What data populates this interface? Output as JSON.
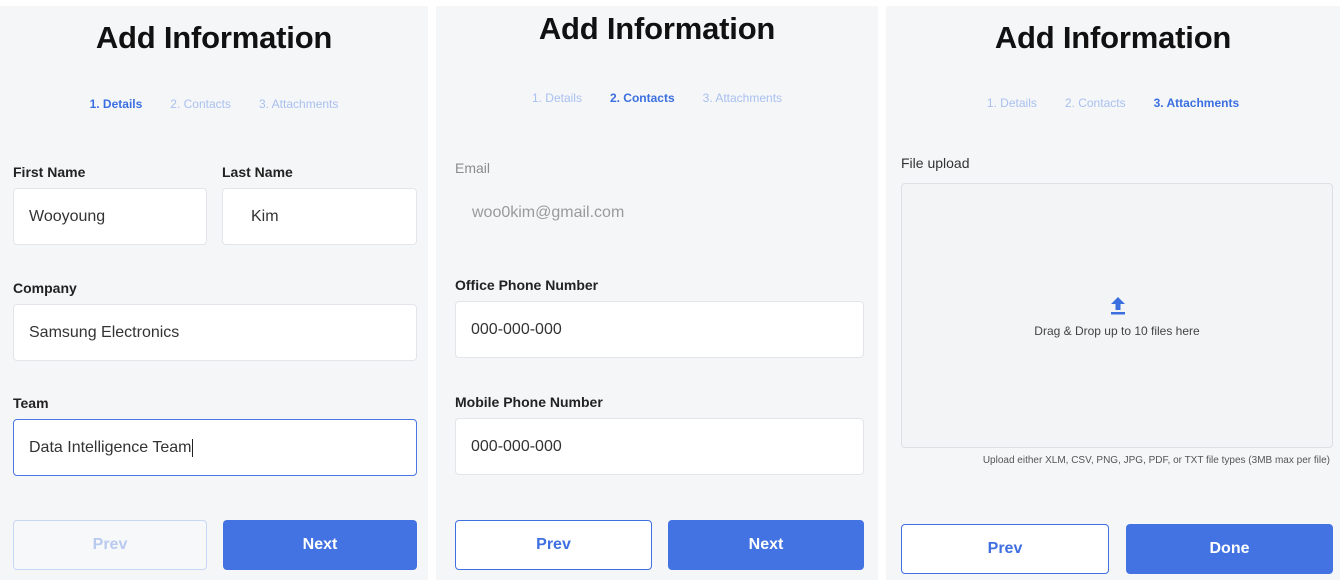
{
  "title": "Add Information",
  "steps": [
    "1. Details",
    "2. Contacts",
    "3. Attachments"
  ],
  "details": {
    "first_name_label": "First Name",
    "first_name_value": "Wooyoung",
    "last_name_label": "Last Name",
    "last_name_value": "Kim",
    "company_label": "Company",
    "company_value": "Samsung Electronics",
    "team_label": "Team",
    "team_value": "Data Intelligence Team",
    "prev_label": "Prev",
    "next_label": "Next"
  },
  "contacts": {
    "email_label": "Email",
    "email_value": "woo0kim@gmail.com",
    "office_label": "Office Phone Number",
    "office_value": "000-000-000",
    "mobile_label": "Mobile Phone Number",
    "mobile_value": "000-000-000",
    "prev_label": "Prev",
    "next_label": "Next"
  },
  "attachments": {
    "upload_label": "File upload",
    "drop_text": "Drag & Drop up to 10 files here",
    "hint": "Upload either XLM, CSV, PNG, JPG, PDF, or TXT file types (3MB max per file)",
    "prev_label": "Prev",
    "done_label": "Done"
  },
  "colors": {
    "primary": "#4372e3",
    "step_active": "#3b6fe0",
    "step_inactive": "#a9c0f0",
    "panel_bg": "#f5f6f8"
  }
}
